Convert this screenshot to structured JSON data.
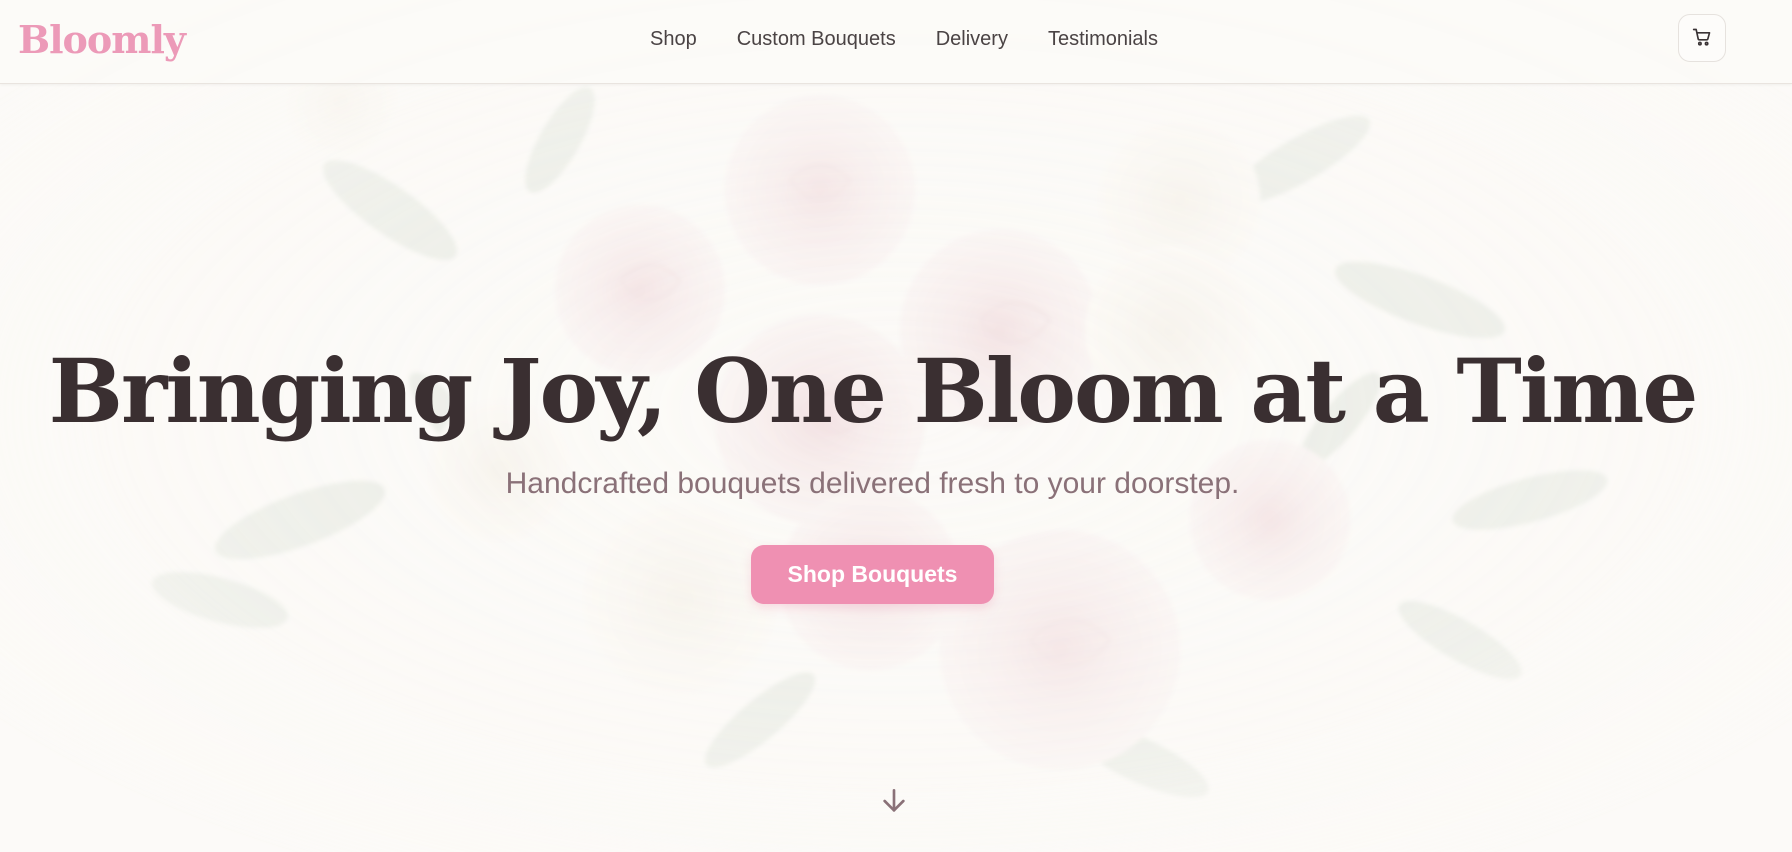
{
  "brand": {
    "name": "Bloomly",
    "color": "#ec9ab8"
  },
  "nav": {
    "items": [
      {
        "label": "Shop"
      },
      {
        "label": "Custom Bouquets"
      },
      {
        "label": "Delivery"
      },
      {
        "label": "Testimonials"
      }
    ]
  },
  "header": {
    "cart_icon": "cart-icon"
  },
  "hero": {
    "title": "Bringing Joy, One Bloom at a Time",
    "subtitle": "Handcrafted bouquets delivered fresh to your doorstep.",
    "cta_label": "Shop Bouquets",
    "scroll_icon": "arrow-down-icon",
    "background": "faded pink roses bouquet"
  },
  "colors": {
    "accent": "#ef90b2",
    "title": "#3a2f31",
    "subtitle": "#8a7178",
    "background": "#fbfaf7"
  }
}
